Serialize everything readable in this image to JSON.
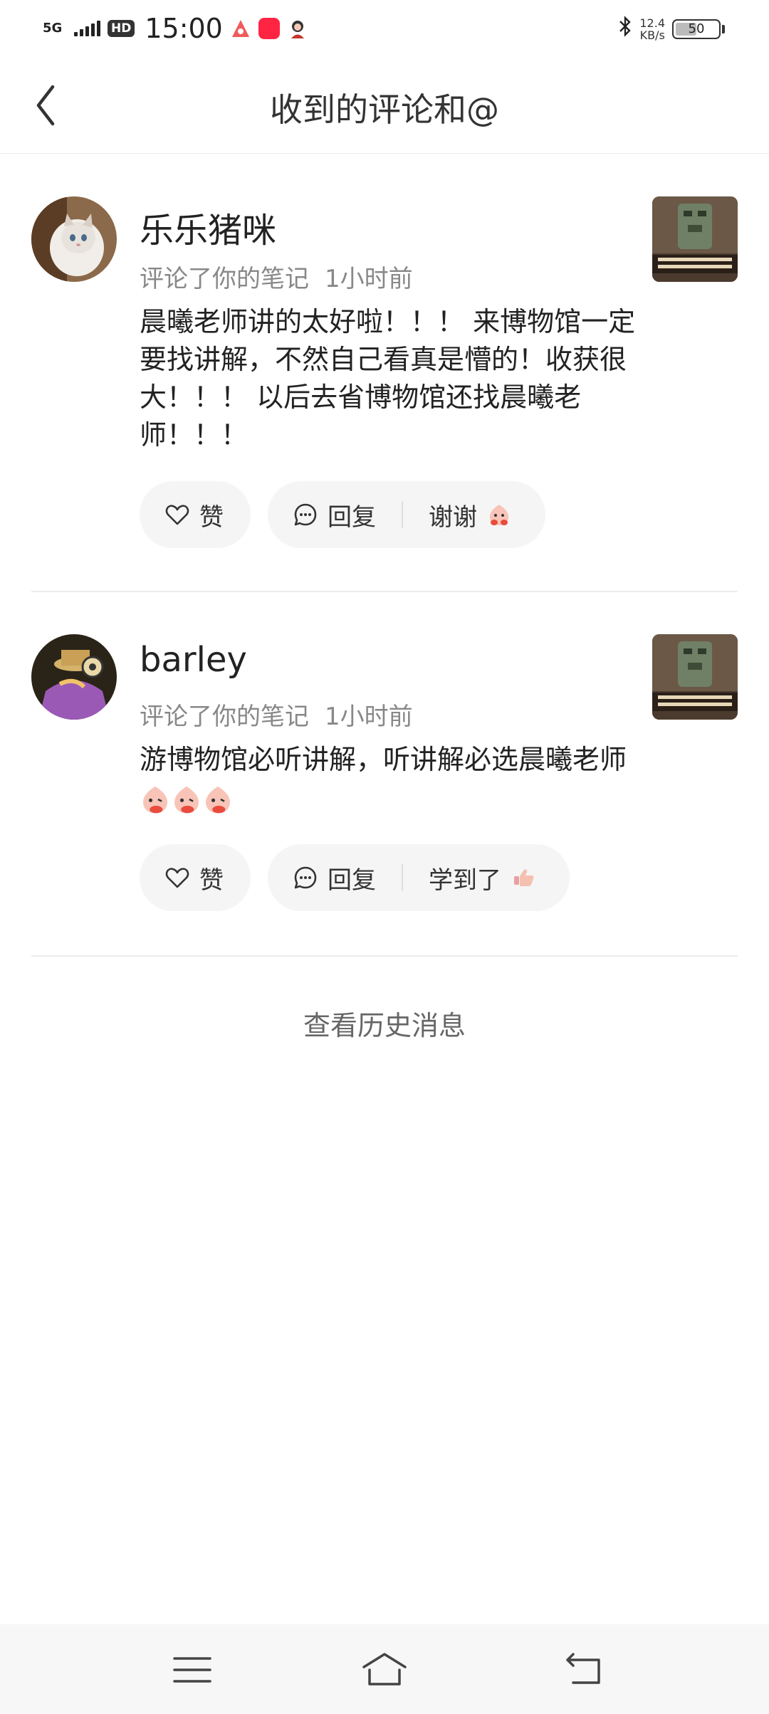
{
  "status_bar": {
    "network": "5G",
    "hd": "HD",
    "time": "15:00",
    "speed_value": "12.4",
    "speed_unit": "KB/s",
    "battery": "50",
    "battery_level": 0.5
  },
  "header": {
    "title": "收到的评论和@"
  },
  "comments": [
    {
      "username": "乐乐猪咪",
      "action": "评论了你的笔记",
      "time": "1小时前",
      "content": "晨曦老师讲的太好啦！！！ 来博物馆一定要找讲解，不然自己看真是懵的！收获很大！！！ 以后去省博物馆还找晨曦老师！！！",
      "like_label": "赞",
      "reply_label": "回复",
      "quick_reply": "谢谢",
      "quick_reply_emoji": "peach-hands-emoji"
    },
    {
      "username": "barley",
      "action": "评论了你的笔记",
      "time": "1小时前",
      "content": "游博物馆必听讲解，听讲解必选晨曦老师",
      "content_emojis": [
        "peach-blush-emoji",
        "peach-blush-emoji",
        "peach-blush-emoji"
      ],
      "like_label": "赞",
      "reply_label": "回复",
      "quick_reply": "学到了",
      "quick_reply_emoji": "thumbs-up-emoji"
    }
  ],
  "footer": {
    "history_link": "查看历史消息"
  },
  "colors": {
    "pill_bg": "#f5f5f5",
    "divider": "#ececec",
    "meta_text": "#888888",
    "nav_bg": "#f7f7f7"
  }
}
